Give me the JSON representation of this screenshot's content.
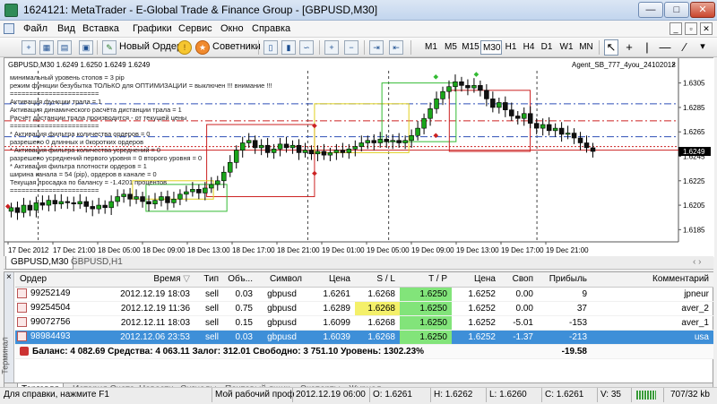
{
  "window": {
    "title": "1624121: MetaTrader - E-Global Trade & Finance Group - [GBPUSD,M30]"
  },
  "menu": {
    "items": [
      "Файл",
      "Вид",
      "Вставка",
      "Графики",
      "Сервис",
      "Окно",
      "Справка"
    ],
    "mdi_buttons": [
      "_",
      "▫",
      "✕"
    ]
  },
  "toolbar": {
    "new_order": "Новый Ордер",
    "advisors": "Советники",
    "timeframes": [
      "M1",
      "M5",
      "M15",
      "M30",
      "H1",
      "H4",
      "D1",
      "W1",
      "MN"
    ],
    "selected_timeframe": "M30"
  },
  "chart_data": {
    "type": "candlestick",
    "header": "GBPUSD,M30  1.6249 1.6250 1.6249 1.6249",
    "expert": "Agent_SB_777_4you_24102012",
    "ylim": [
      1.6175,
      1.6315
    ],
    "y_ticks": [
      "1.6305",
      "1.6285",
      "1.6265",
      "1.6245",
      "1.6225",
      "1.6205",
      "1.6185"
    ],
    "current_price": "1.6249",
    "x_ticks": [
      "17 Dec 2012",
      "17 Dec 21:00",
      "18 Dec 05:00",
      "18 Dec 09:00",
      "18 Dec 13:00",
      "18 Dec 17:00",
      "18 Dec 21:00",
      "19 Dec 01:00",
      "19 Dec 05:00",
      "19 Dec 09:00",
      "19 Dec 13:00",
      "19 Dec 17:00",
      "19 Dec 21:00"
    ],
    "candles_close": [
      1.6203,
      1.6199,
      1.6205,
      1.6201,
      1.6207,
      1.6205,
      1.6209,
      1.6206,
      1.6208,
      1.6207,
      1.6206,
      1.6208,
      1.6204,
      1.6202,
      1.6205,
      1.6203,
      1.6208,
      1.6212,
      1.6214,
      1.621,
      1.6212,
      1.6208,
      1.6206,
      1.6209,
      1.6212,
      1.6207,
      1.621,
      1.6214,
      1.6216,
      1.6218,
      1.6215,
      1.6219,
      1.6222,
      1.6225,
      1.6232,
      1.624,
      1.625,
      1.6256,
      1.6258,
      1.6252,
      1.6254,
      1.6248,
      1.6251,
      1.6255,
      1.6252,
      1.6254,
      1.6248,
      1.625,
      1.6247,
      1.6249,
      1.6246,
      1.6248,
      1.625,
      1.6248,
      1.6251,
      1.6253,
      1.6256,
      1.6258,
      1.6256,
      1.6259,
      1.6257,
      1.6258,
      1.6256,
      1.6258,
      1.6262,
      1.6268,
      1.6276,
      1.6284,
      1.6292,
      1.6298,
      1.6302,
      1.6306,
      1.6303,
      1.6301,
      1.6303,
      1.6299,
      1.6292,
      1.6285,
      1.6289,
      1.6283,
      1.6278,
      1.6276,
      1.628,
      1.6272,
      1.6268,
      1.6271,
      1.6266,
      1.6268,
      1.6263,
      1.6264,
      1.626,
      1.6256,
      1.6252,
      1.6249
    ],
    "horizontal_lines": [
      {
        "price": 1.6288,
        "color": "#2e4fb6",
        "style": "dashdot"
      },
      {
        "price": 1.6274,
        "color": "#cc2222",
        "style": "dashdot"
      },
      {
        "price": 1.6261,
        "color": "#2e4fb6",
        "style": "dashdot"
      },
      {
        "price": 1.625,
        "color": "#cc2222",
        "style": "solid"
      },
      {
        "price": 1.6253,
        "color": "#cc2222",
        "style": "dotted"
      }
    ],
    "boxes": [
      {
        "t0": 0.3,
        "t1": 0.46,
        "p0": 1.6271,
        "p1": 1.6212,
        "color": "#cc2222"
      },
      {
        "t0": 0.19,
        "t1": 0.31,
        "p0": 1.6225,
        "p1": 1.621,
        "color": "#e0d020"
      },
      {
        "t0": 0.21,
        "t1": 0.33,
        "p0": 1.6222,
        "p1": 1.62,
        "color": "#33bb33"
      },
      {
        "t0": 0.46,
        "t1": 0.6,
        "p0": 1.6288,
        "p1": 1.6248,
        "color": "#e0d020"
      },
      {
        "t0": 0.56,
        "t1": 0.67,
        "p0": 1.6305,
        "p1": 1.6257,
        "color": "#33bb33"
      },
      {
        "t0": 0.66,
        "t1": 0.78,
        "p0": 1.6299,
        "p1": 1.6249,
        "color": "#cc2222"
      }
    ],
    "vlines": [
      0.05,
      0.45,
      0.57,
      0.79
    ],
    "grid": false
  },
  "chart_text": [
    "минимальный уровень стопов = 3  pip",
    "режим функции безубытка ТОЛЬКО для ОПТИМИЗАЦИИ = выключен !!! внимание !!!",
    "=======================",
    "Активация функции трала = 1",
    "Активация динамического расчёта дистанции трала = 1",
    "Расчёт дистанции трала производится - от текущей цены",
    "=======================",
    "* Активация фильтра количества ордеров = 0",
    "разрешено 0 длинных и 0коротких ордеров",
    "* Активация фильтра количества усреднений = 0",
    "разрешено усреднений первого уровня = 0 второго уровня = 0",
    "* Активация фильтра плотности ордеров = 1",
    "ширина канала = 54 (pip), ордеров в канале = 0",
    "Текущая просадка по балансу = -1.4201 процентов",
    "======================="
  ],
  "chart_tabs": [
    "GBPUSD,M30",
    "GBPUSD,H1"
  ],
  "orders": {
    "columns": [
      "Ордер",
      "Время",
      "Тип",
      "Объ...",
      "Символ",
      "Цена",
      "S / L",
      "T / P",
      "Цена",
      "Своп",
      "Прибыль",
      "Комментарий"
    ],
    "sort_indicator": "▽",
    "rows": [
      {
        "order": "99252149",
        "time": "2012.12.19 18:03",
        "type": "sell",
        "volume": "0.03",
        "symbol": "gbpusd",
        "price": "1.6261",
        "sl": "1.6268",
        "tp": "1.6250",
        "cur_price": "1.6252",
        "swap": "0.00",
        "profit": "9",
        "comment": "jpneur"
      },
      {
        "order": "99254504",
        "time": "2012.12.19 11:36",
        "type": "sell",
        "volume": "0.75",
        "symbol": "gbpusd",
        "price": "1.6289",
        "sl": "1.6268",
        "tp": "1.6250",
        "cur_price": "1.6252",
        "swap": "0.00",
        "profit": "37",
        "comment": "aver_2"
      },
      {
        "order": "99072756",
        "time": "2012.12.11 18:03",
        "type": "sell",
        "volume": "0.15",
        "symbol": "gbpusd",
        "price": "1.6099",
        "sl": "1.6268",
        "tp": "1.6250",
        "cur_price": "1.6252",
        "swap": "-5.01",
        "profit": "-153",
        "comment": "aver_1"
      },
      {
        "order": "98984493",
        "time": "2012.12.06 23:53",
        "type": "sell",
        "volume": "0.03",
        "symbol": "gbpusd",
        "price": "1.6039",
        "sl": "1.6268",
        "tp": "1.6250",
        "cur_price": "1.6252",
        "swap": "-1.37",
        "profit": "-213",
        "comment": "usa"
      }
    ],
    "balance_line": "Баланс: 4 082.69  Средства: 4 063.11  Залог: 312.01  Свободно: 3 751.10  Уровень: 1302.23%",
    "total_profit": "-19.58"
  },
  "terminal": {
    "side_label": "Терминал",
    "tabs": [
      "Торговля",
      "История Счета",
      "Новости",
      "Сигналы",
      "Почтовый ящик",
      "Эксперты",
      "Журнал"
    ]
  },
  "status": {
    "help": "Для справки, нажмите F1",
    "profile": "Мой рабочий проф",
    "datetime": "2012.12.19 06:00",
    "open": "O: 1.6261",
    "high": "H: 1.6262",
    "low": "L: 1.6260",
    "close": "C: 1.6261",
    "volume": "V: 35",
    "traffic": "707/32 kb"
  }
}
